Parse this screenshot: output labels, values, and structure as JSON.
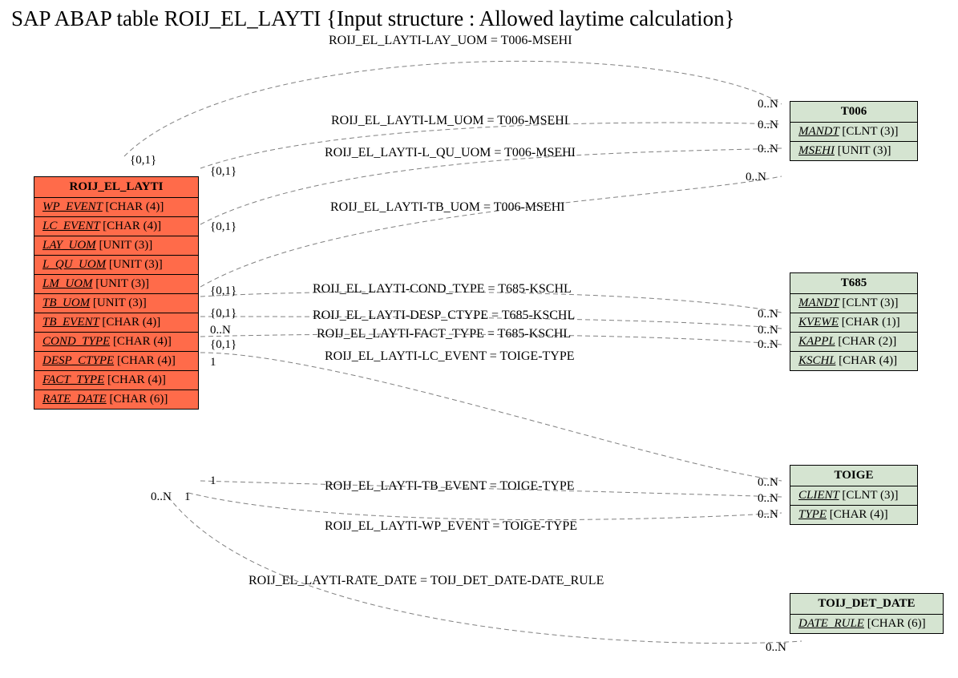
{
  "title": "SAP ABAP table ROIJ_EL_LAYTI {Input structure : Allowed laytime calculation}",
  "entities": {
    "main": {
      "name": "ROIJ_EL_LAYTI",
      "fields": [
        {
          "n": "WP_EVENT",
          "t": "[CHAR (4)]"
        },
        {
          "n": "LC_EVENT",
          "t": "[CHAR (4)]"
        },
        {
          "n": "LAY_UOM",
          "t": "[UNIT (3)]"
        },
        {
          "n": "L_QU_UOM",
          "t": "[UNIT (3)]"
        },
        {
          "n": "LM_UOM",
          "t": "[UNIT (3)]"
        },
        {
          "n": "TB_UOM",
          "t": "[UNIT (3)]"
        },
        {
          "n": "TB_EVENT",
          "t": "[CHAR (4)]"
        },
        {
          "n": "COND_TYPE",
          "t": "[CHAR (4)]"
        },
        {
          "n": "DESP_CTYPE",
          "t": "[CHAR (4)]"
        },
        {
          "n": "FACT_TYPE",
          "t": "[CHAR (4)]"
        },
        {
          "n": "RATE_DATE",
          "t": "[CHAR (6)]"
        }
      ]
    },
    "t006": {
      "name": "T006",
      "fields": [
        {
          "n": "MANDT",
          "t": "[CLNT (3)]"
        },
        {
          "n": "MSEHI",
          "t": "[UNIT (3)]"
        }
      ]
    },
    "t685": {
      "name": "T685",
      "fields": [
        {
          "n": "MANDT",
          "t": "[CLNT (3)]"
        },
        {
          "n": "KVEWE",
          "t": "[CHAR (1)]"
        },
        {
          "n": "KAPPL",
          "t": "[CHAR (2)]"
        },
        {
          "n": "KSCHL",
          "t": "[CHAR (4)]"
        }
      ]
    },
    "toige": {
      "name": "TOIGE",
      "fields": [
        {
          "n": "CLIENT",
          "t": "[CLNT (3)]"
        },
        {
          "n": "TYPE",
          "t": "[CHAR (4)]"
        }
      ]
    },
    "toij": {
      "name": "TOIJ_DET_DATE",
      "fields": [
        {
          "n": "DATE_RULE",
          "t": "[CHAR (6)]"
        }
      ]
    }
  },
  "relations": {
    "r1": "ROIJ_EL_LAYTI-LAY_UOM = T006-MSEHI",
    "r2": "ROIJ_EL_LAYTI-LM_UOM = T006-MSEHI",
    "r3": "ROIJ_EL_LAYTI-L_QU_UOM = T006-MSEHI",
    "r4": "ROIJ_EL_LAYTI-TB_UOM = T006-MSEHI",
    "r5": "ROIJ_EL_LAYTI-COND_TYPE = T685-KSCHL",
    "r6": "ROIJ_EL_LAYTI-DESP_CTYPE = T685-KSCHL",
    "r7": "ROIJ_EL_LAYTI-FACT_TYPE = T685-KSCHL",
    "r8": "ROIJ_EL_LAYTI-LC_EVENT = TOIGE-TYPE",
    "r9": "ROIJ_EL_LAYTI-TB_EVENT = TOIGE-TYPE",
    "r10": "ROIJ_EL_LAYTI-WP_EVENT = TOIGE-TYPE",
    "r11": "ROIJ_EL_LAYTI-RATE_DATE = TOIJ_DET_DATE-DATE_RULE"
  },
  "cards": {
    "c_main_01a": "{0,1}",
    "c_main_01b": "{0,1}",
    "c_main_01c": "{0,1}",
    "c_main_01d": "{0,1}",
    "c_main_01e": "{0,1}",
    "c_main_0N": "0..N",
    "c_main_01f": "{0,1}",
    "c_main_1a": "1",
    "c_main_1b": "1",
    "c_main_1c": "1",
    "c_main_0Nb": "0..N",
    "c_t006_a": "0..N",
    "c_t006_b": "0..N",
    "c_t006_c": "0..N",
    "c_t006_d": "0..N",
    "c_t685_a": "0..N",
    "c_t685_b": "0..N",
    "c_t685_c": "0..N",
    "c_toige_a": "0..N",
    "c_toige_b": "0..N",
    "c_toige_c": "0..N",
    "c_toij_a": "0..N"
  }
}
